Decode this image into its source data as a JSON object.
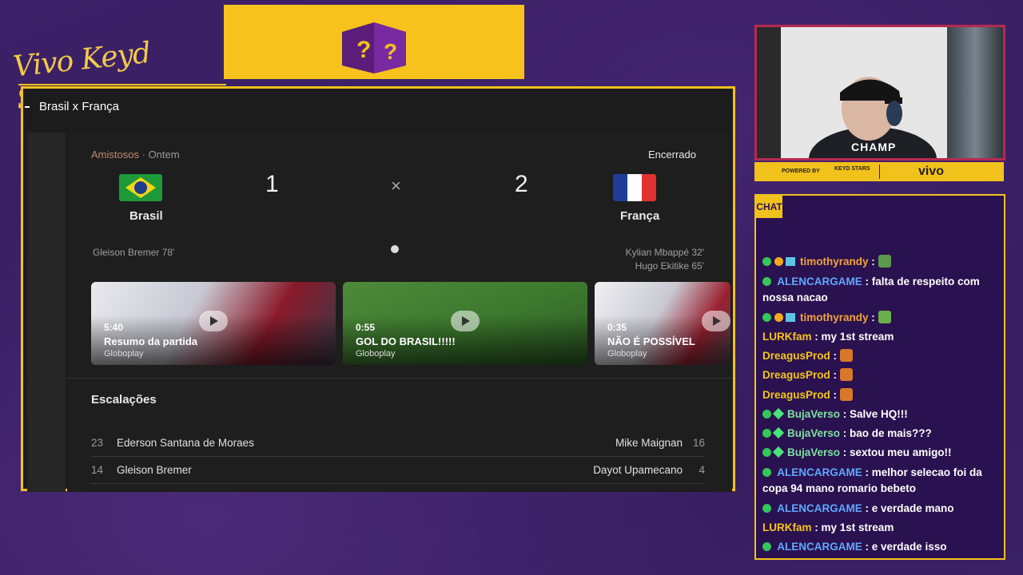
{
  "brand": {
    "title": "Vivo Keyd Stars"
  },
  "game": {
    "header": "Brasil x França",
    "competition": "Amistosos",
    "competition_sep": "·",
    "date": "Ontem",
    "status": "Encerrado",
    "home_team": "Brasil",
    "away_team": "França",
    "home_score": "1",
    "away_score": "2",
    "vs_symbol": "×",
    "home_scorers": [
      "Gleison Bremer 78'"
    ],
    "away_scorers": [
      "Kylian Mbappé 32'",
      "Hugo Ekitike 65'"
    ],
    "videos": [
      {
        "duration": "5:40",
        "title": "Resumo da partida",
        "source": "Globoplay"
      },
      {
        "duration": "0:55",
        "title": "GOL DO BRASIL!!!!!",
        "source": "Globoplay"
      },
      {
        "duration": "0:35",
        "title": "NÃO É POSSÍVEL",
        "source": "Globoplay"
      }
    ],
    "lineups_title": "Escalações",
    "lineups": [
      {
        "home_num": "23",
        "home_name": "Ederson Santana de Moraes",
        "away_name": "Mike Maignan",
        "away_num": "16"
      },
      {
        "home_num": "14",
        "home_name": "Gleison Bremer",
        "away_name": "Dayot Upamecano",
        "away_num": "4"
      }
    ]
  },
  "camera": {
    "overlay_text": "CHAMP",
    "powered_by": "POWERED BY",
    "sponsor_small": "KEYD STARS",
    "sponsor": "vivo"
  },
  "chat": {
    "label": "CHAT",
    "messages": [
      {
        "user": "timothyrandy",
        "text": ""
      },
      {
        "user": "ALENCARGAME",
        "text": "falta de respeito com nossa nacao"
      },
      {
        "user": "timothyrandy",
        "text": ""
      },
      {
        "user": "LURKfam",
        "text": "my 1st stream"
      },
      {
        "user": "DreagusProd",
        "text": ""
      },
      {
        "user": "DreagusProd",
        "text": ""
      },
      {
        "user": "DreagusProd",
        "text": ""
      },
      {
        "user": "BujaVerso",
        "text": "Salve HQ!!!"
      },
      {
        "user": "BujaVerso",
        "text": "bao de mais???"
      },
      {
        "user": "BujaVerso",
        "text": "sextou meu amigo!!"
      },
      {
        "user": "ALENCARGAME",
        "text": "melhor selecao foi da copa 94 mano romario bebeto"
      },
      {
        "user": "ALENCARGAME",
        "text": "e verdade mano"
      },
      {
        "user": "LURKfam",
        "text": "my 1st stream"
      },
      {
        "user": "ALENCARGAME",
        "text": "e verdade isso"
      }
    ]
  }
}
